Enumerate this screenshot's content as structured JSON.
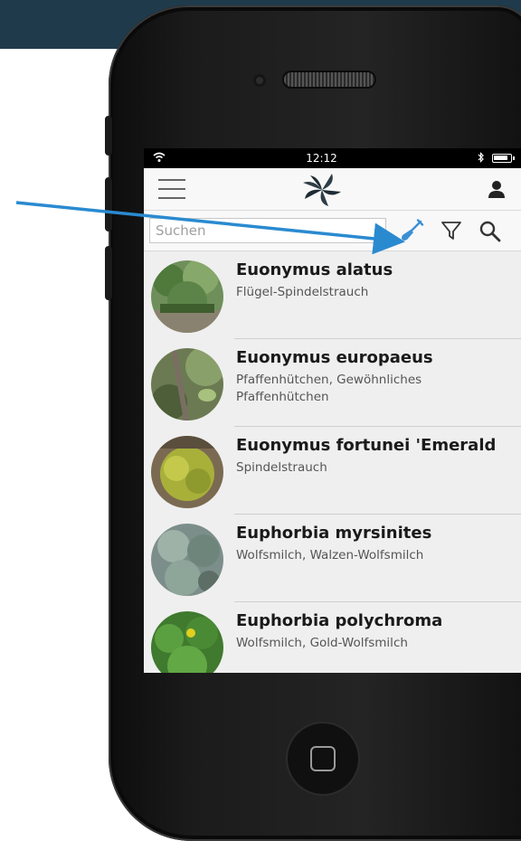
{
  "status": {
    "time": "12:12"
  },
  "search": {
    "placeholder": "Suchen",
    "value": ""
  },
  "plants": [
    {
      "name": "Euonymus alatus",
      "common": "Flügel-Spindelstrauch"
    },
    {
      "name": "Euonymus europaeus",
      "common": "Pfaffenhütchen, Gewöhnliches Pfaffenhütchen"
    },
    {
      "name": "Euonymus fortunei 'Emerald",
      "common": "Spindelstrauch"
    },
    {
      "name": "Euphorbia myrsinites",
      "common": "Wolfsmilch, Walzen-Wolfsmilch"
    },
    {
      "name": "Euphorbia polychroma",
      "common": "Wolfsmilch, Gold-Wolfsmilch"
    }
  ],
  "icons": {
    "menu": "menu-icon",
    "logo": "leaf-logo-icon",
    "user": "user-icon",
    "shovel": "shovel-icon",
    "filter": "filter-icon",
    "search": "search-icon",
    "wifi": "wifi-icon",
    "bluetooth": "bluetooth-icon",
    "battery": "battery-icon"
  },
  "colors": {
    "banner": "#1f3a4b",
    "accent_blue": "#3a8fd6",
    "screen_bg": "#efefef",
    "text_primary": "#1a1a1a",
    "text_secondary": "#555555"
  }
}
